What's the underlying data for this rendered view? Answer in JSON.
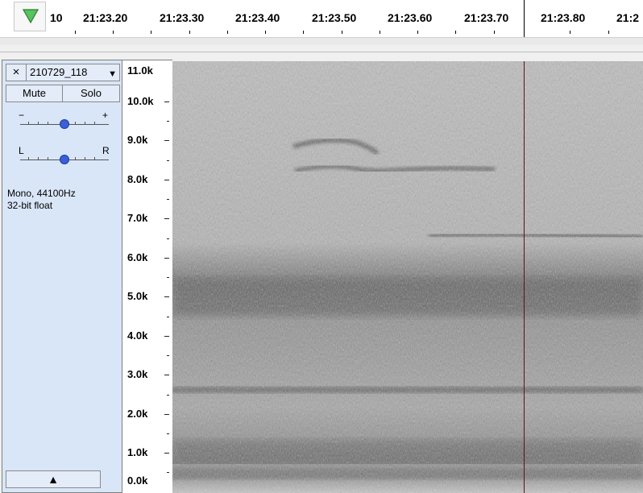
{
  "ruler": {
    "ticks": [
      "10",
      "21:23.20",
      "21:23.30",
      "21:23.40",
      "21:23.50",
      "21:23.60",
      "21:23.70",
      "21:23.80",
      "21:2"
    ]
  },
  "track": {
    "close_label": "×",
    "name": "210729_118",
    "mute_label": "Mute",
    "solo_label": "Solo",
    "gain_minus": "−",
    "gain_plus": "+",
    "pan_left": "L",
    "pan_right": "R",
    "format_line1": "Mono, 44100Hz",
    "format_line2": "32-bit float",
    "collapse_label": "▲"
  },
  "frequency_scale": {
    "labels": [
      "11.0k",
      "10.0k",
      "9.0k",
      "8.0k",
      "7.0k",
      "6.0k",
      "5.0k",
      "4.0k",
      "3.0k",
      "2.0k",
      "1.0k",
      "0.0k"
    ]
  },
  "colors": {
    "track_panel": "#d9e6f7",
    "slider_knob": "#3b5fd8",
    "cursor_line": "#5a1414",
    "play_arrow": "#2e9e3a"
  },
  "icons": {
    "play_head": "green-down-triangle-icon",
    "close": "close-icon",
    "menu_caret": "chevron-down-icon",
    "collapse": "collapse-up-icon"
  }
}
